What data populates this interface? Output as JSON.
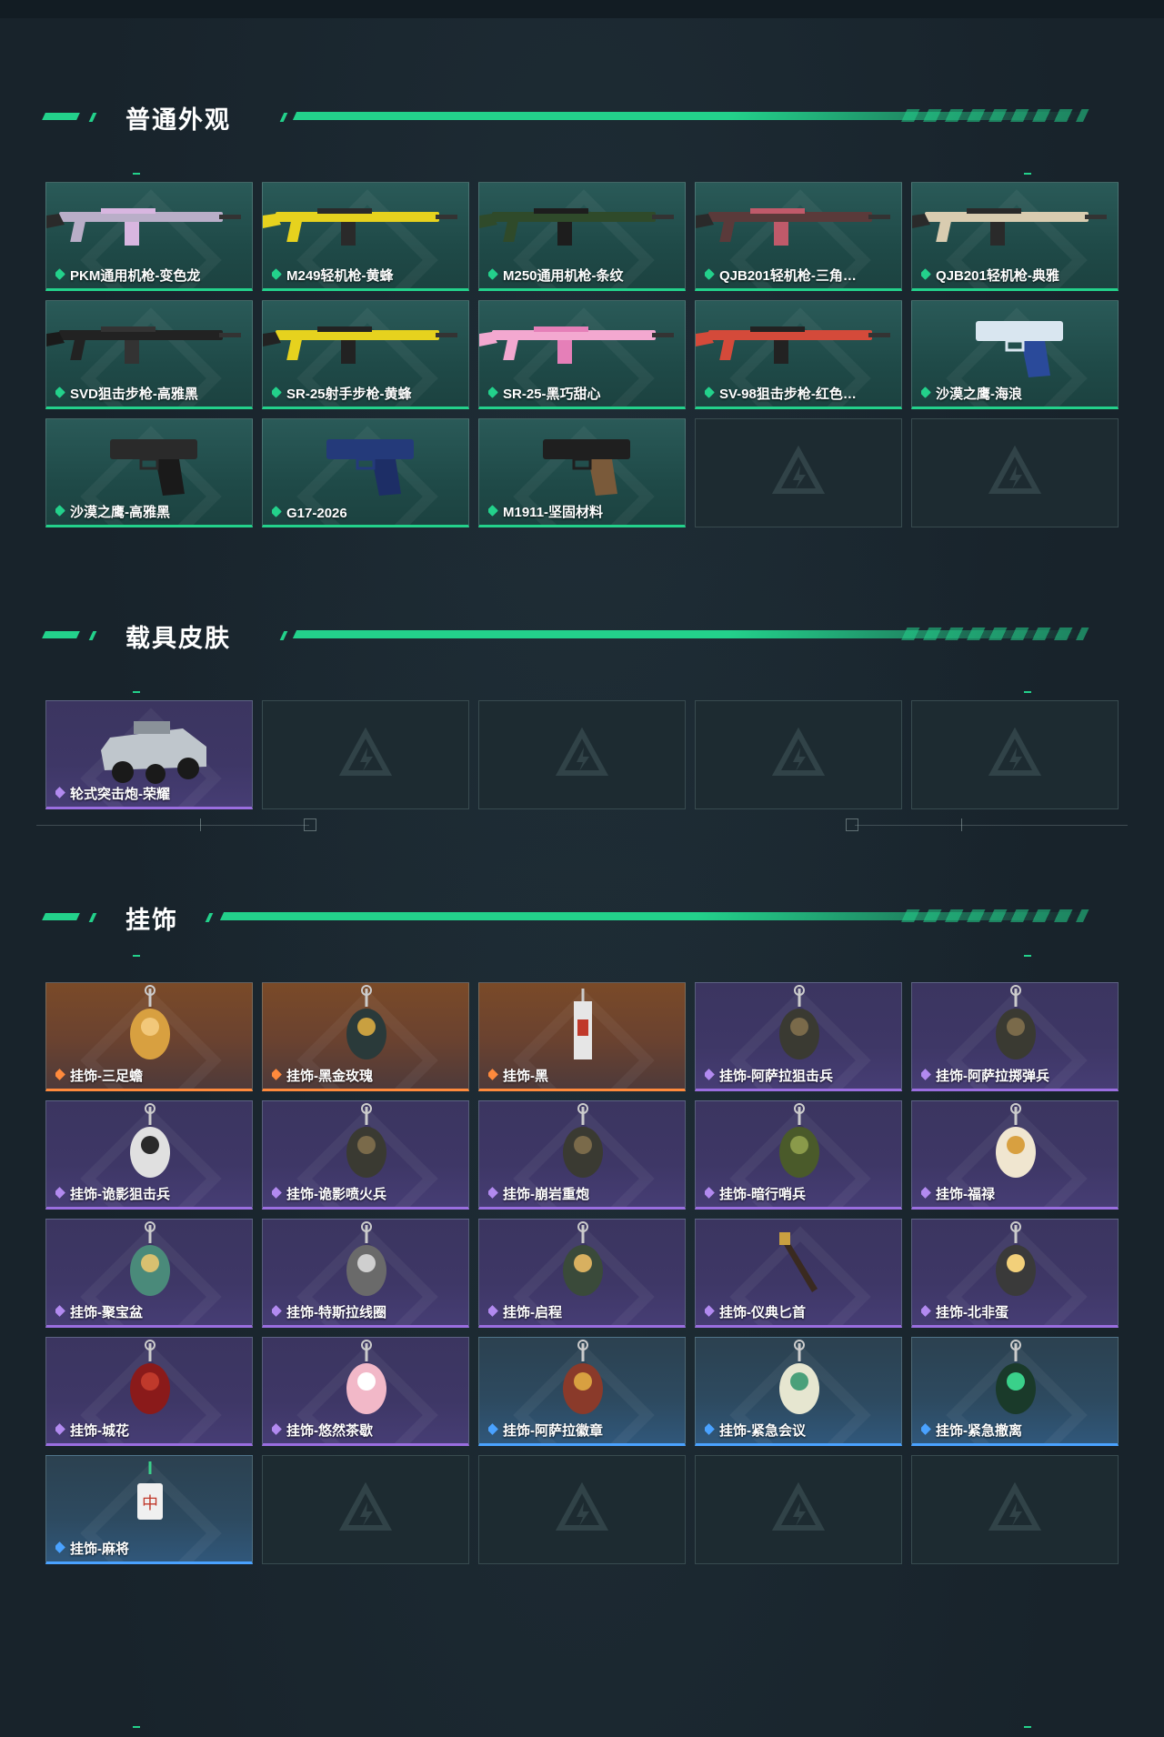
{
  "sections": [
    {
      "title": "普通外观",
      "items": [
        {
          "label": "PKM通用机枪-变色龙",
          "rarity": "green",
          "art": "rifle-gray-pink"
        },
        {
          "label": "M249轻机枪-黄蜂",
          "rarity": "green",
          "art": "rifle-yellow"
        },
        {
          "label": "M250通用机枪-条纹",
          "rarity": "green",
          "art": "rifle-green"
        },
        {
          "label": "QJB201轻机枪-三角…",
          "rarity": "green",
          "art": "rifle-red"
        },
        {
          "label": "QJB201轻机枪-典雅",
          "rarity": "green",
          "art": "rifle-beige"
        },
        {
          "label": "SVD狙击步枪-高雅黑",
          "rarity": "green",
          "art": "sniper-black"
        },
        {
          "label": "SR-25射手步枪-黄蜂",
          "rarity": "green",
          "art": "sniper-yellow"
        },
        {
          "label": "SR-25-黑巧甜心",
          "rarity": "green",
          "art": "rifle-pink"
        },
        {
          "label": "SV-98狙击步枪-红色…",
          "rarity": "green",
          "art": "sniper-red"
        },
        {
          "label": "沙漠之鹰-海浪",
          "rarity": "green",
          "art": "pistol-blue"
        },
        {
          "label": "沙漠之鹰-高雅黑",
          "rarity": "green",
          "art": "pistol-black"
        },
        {
          "label": "G17-2026",
          "rarity": "green",
          "art": "pistol-navy"
        },
        {
          "label": "M1911-坚固材料",
          "rarity": "green",
          "art": "pistol-brown"
        },
        {
          "label": "",
          "rarity": "empty"
        },
        {
          "label": "",
          "rarity": "empty"
        }
      ]
    },
    {
      "title": "载具皮肤",
      "items": [
        {
          "label": "轮式突击炮-荣耀",
          "rarity": "purple",
          "art": "vehicle"
        },
        {
          "label": "",
          "rarity": "empty"
        },
        {
          "label": "",
          "rarity": "empty"
        },
        {
          "label": "",
          "rarity": "empty"
        },
        {
          "label": "",
          "rarity": "empty"
        }
      ]
    },
    {
      "title": "挂饰",
      "items": [
        {
          "label": "挂饰-三足蟾",
          "rarity": "orange",
          "art": "charm-gold"
        },
        {
          "label": "挂饰-黑金玫瑰",
          "rarity": "orange",
          "art": "charm-dark"
        },
        {
          "label": "挂饰-黑",
          "rarity": "orange",
          "art": "charm-tag"
        },
        {
          "label": "挂饰-阿萨拉狙击兵",
          "rarity": "purple",
          "art": "charm-soldier"
        },
        {
          "label": "挂饰-阿萨拉掷弹兵",
          "rarity": "purple",
          "art": "charm-soldier"
        },
        {
          "label": "挂饰-诡影狙击兵",
          "rarity": "purple",
          "art": "charm-skull"
        },
        {
          "label": "挂饰-诡影喷火兵",
          "rarity": "purple",
          "art": "charm-soldier"
        },
        {
          "label": "挂饰-崩岩重炮",
          "rarity": "purple",
          "art": "charm-soldier"
        },
        {
          "label": "挂饰-暗行哨兵",
          "rarity": "purple",
          "art": "charm-green"
        },
        {
          "label": "挂饰-福禄",
          "rarity": "purple",
          "art": "charm-gourd"
        },
        {
          "label": "挂饰-聚宝盆",
          "rarity": "purple",
          "art": "charm-dragon"
        },
        {
          "label": "挂饰-特斯拉线圈",
          "rarity": "purple",
          "art": "charm-coil"
        },
        {
          "label": "挂饰-启程",
          "rarity": "purple",
          "art": "charm-medal"
        },
        {
          "label": "挂饰-仪典匕首",
          "rarity": "purple",
          "art": "charm-knife"
        },
        {
          "label": "挂饰-北非蛋",
          "rarity": "purple",
          "art": "charm-pan"
        },
        {
          "label": "挂饰-城花",
          "rarity": "purple",
          "art": "charm-rose"
        },
        {
          "label": "挂饰-悠然茶歇",
          "rarity": "purple",
          "art": "charm-cake"
        },
        {
          "label": "挂饰-阿萨拉徽章",
          "rarity": "blue",
          "art": "charm-badge"
        },
        {
          "label": "挂饰-紧急会议",
          "rarity": "blue",
          "art": "charm-sign"
        },
        {
          "label": "挂饰-紧急撤离",
          "rarity": "blue",
          "art": "charm-exit"
        },
        {
          "label": "挂饰-麻将",
          "rarity": "blue",
          "art": "charm-mahjong"
        },
        {
          "label": "",
          "rarity": "empty"
        },
        {
          "label": "",
          "rarity": "empty"
        },
        {
          "label": "",
          "rarity": "empty"
        },
        {
          "label": "",
          "rarity": "empty"
        }
      ]
    }
  ],
  "colors": {
    "accent": "#23d18b",
    "purple": "#9a6ee0",
    "orange": "#ff8a3c",
    "blue": "#4aa2ff"
  }
}
